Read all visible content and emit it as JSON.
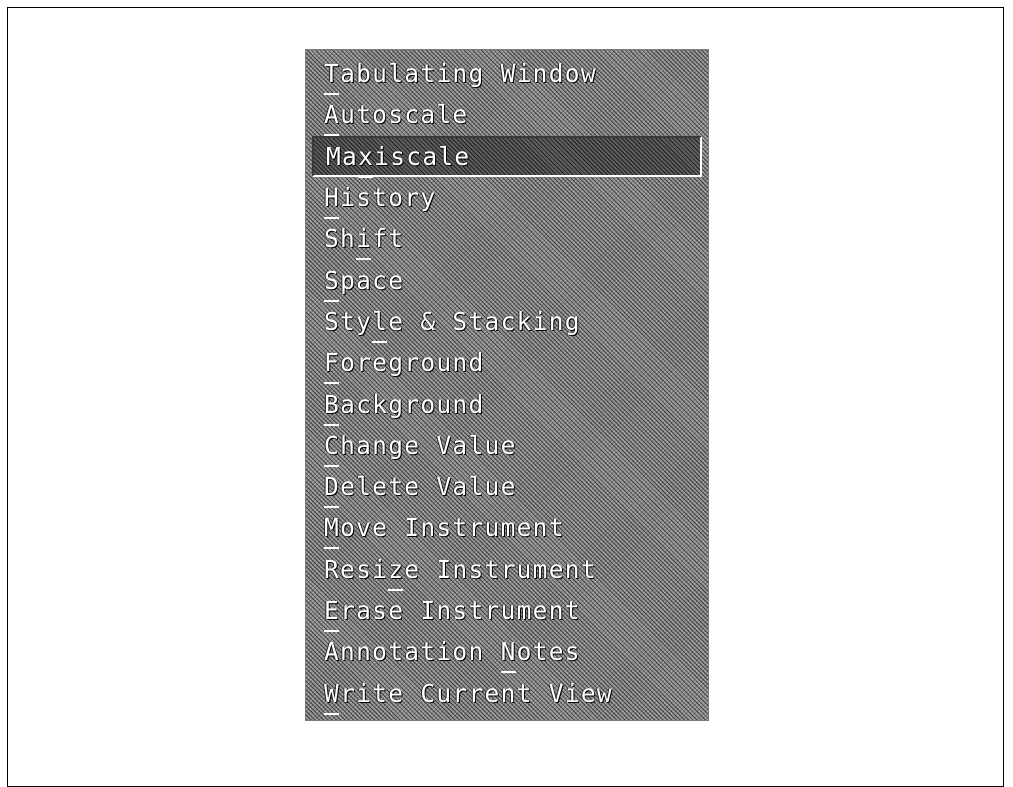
{
  "menu": {
    "items": [
      {
        "label": "Tabulating Window",
        "mnemonic_index": 0
      },
      {
        "label": "Autoscale",
        "mnemonic_index": 0
      },
      {
        "label": "Maxiscale",
        "mnemonic_index": 2,
        "selected": true
      },
      {
        "label": "History",
        "mnemonic_index": 0
      },
      {
        "label": "Shift",
        "mnemonic_index": 2
      },
      {
        "label": "Space",
        "mnemonic_index": 0
      },
      {
        "label": "Style & Stacking",
        "mnemonic_index": 3
      },
      {
        "label": "Foreground",
        "mnemonic_index": 0
      },
      {
        "label": "Background",
        "mnemonic_index": 0
      },
      {
        "label": "Change Value",
        "mnemonic_index": 0
      },
      {
        "label": "Delete Value",
        "mnemonic_index": 0
      },
      {
        "label": "Move Instrument",
        "mnemonic_index": 0
      },
      {
        "label": "Resize Instrument",
        "mnemonic_index": 4
      },
      {
        "label": "Erase Instrument",
        "mnemonic_index": 0
      },
      {
        "label": "Annotation Notes",
        "mnemonic_index": 11
      },
      {
        "label": "Write Current View",
        "mnemonic_index": 0
      }
    ]
  },
  "colors": {
    "menu_background": "#8a8a8a",
    "text": "#ffffff",
    "page_background": "#ffffff",
    "frame_border": "#000000"
  }
}
